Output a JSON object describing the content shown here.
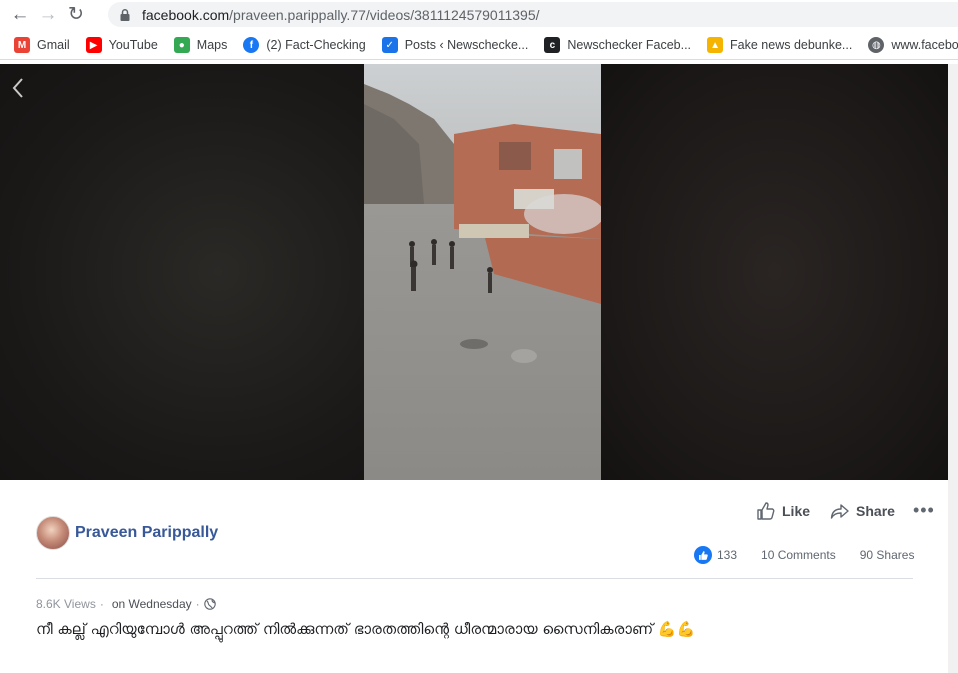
{
  "browser": {
    "url_host": "facebook.com",
    "url_path": "/praveen.parippally.77/videos/3811124579011395/",
    "back_glyph": "←",
    "forward_glyph": "→",
    "reload_glyph": "↻",
    "bookmarks": [
      {
        "label": "Gmail",
        "icon": "gmail-icon",
        "color": "#ea4335"
      },
      {
        "label": "YouTube",
        "icon": "youtube-icon",
        "color": "#ff0000"
      },
      {
        "label": "Maps",
        "icon": "maps-icon",
        "color": "#34a853"
      },
      {
        "label": "(2) Fact-Checking",
        "icon": "facebook-icon",
        "color": "#1877f2"
      },
      {
        "label": "Posts ‹ Newschecke...",
        "icon": "newschecker-icon",
        "color": "#1a73e8"
      },
      {
        "label": "Newschecker Faceb...",
        "icon": "nc-icon",
        "color": "#202124"
      },
      {
        "label": "Fake news debunke...",
        "icon": "drive-icon",
        "color": "#f4b400"
      },
      {
        "label": "www.facebook.com",
        "icon": "globe-icon",
        "color": "#5f6368"
      }
    ]
  },
  "video": {
    "back_icon": "chevron-left-icon"
  },
  "post": {
    "actions": {
      "like_label": "Like",
      "share_label": "Share",
      "more_label": "•••"
    },
    "author_name": "Praveen Parippally",
    "stats": {
      "likes": "133",
      "comments": "10 Comments",
      "shares": "90 Shares"
    },
    "meta": {
      "views": "8.6K Views",
      "separator": "·",
      "when": "on Wednesday"
    },
    "caption": "നീ കല്ല് എറിയുമ്പോൾ അപ്പുറത്ത് നിൽക്കുന്നത് ഭാരതത്തിന്റെ ധീരന്മാരായ സൈനികരാണ് 💪💪"
  },
  "colors": {
    "facebook_blue": "#1877f2",
    "author_link": "#385898"
  }
}
